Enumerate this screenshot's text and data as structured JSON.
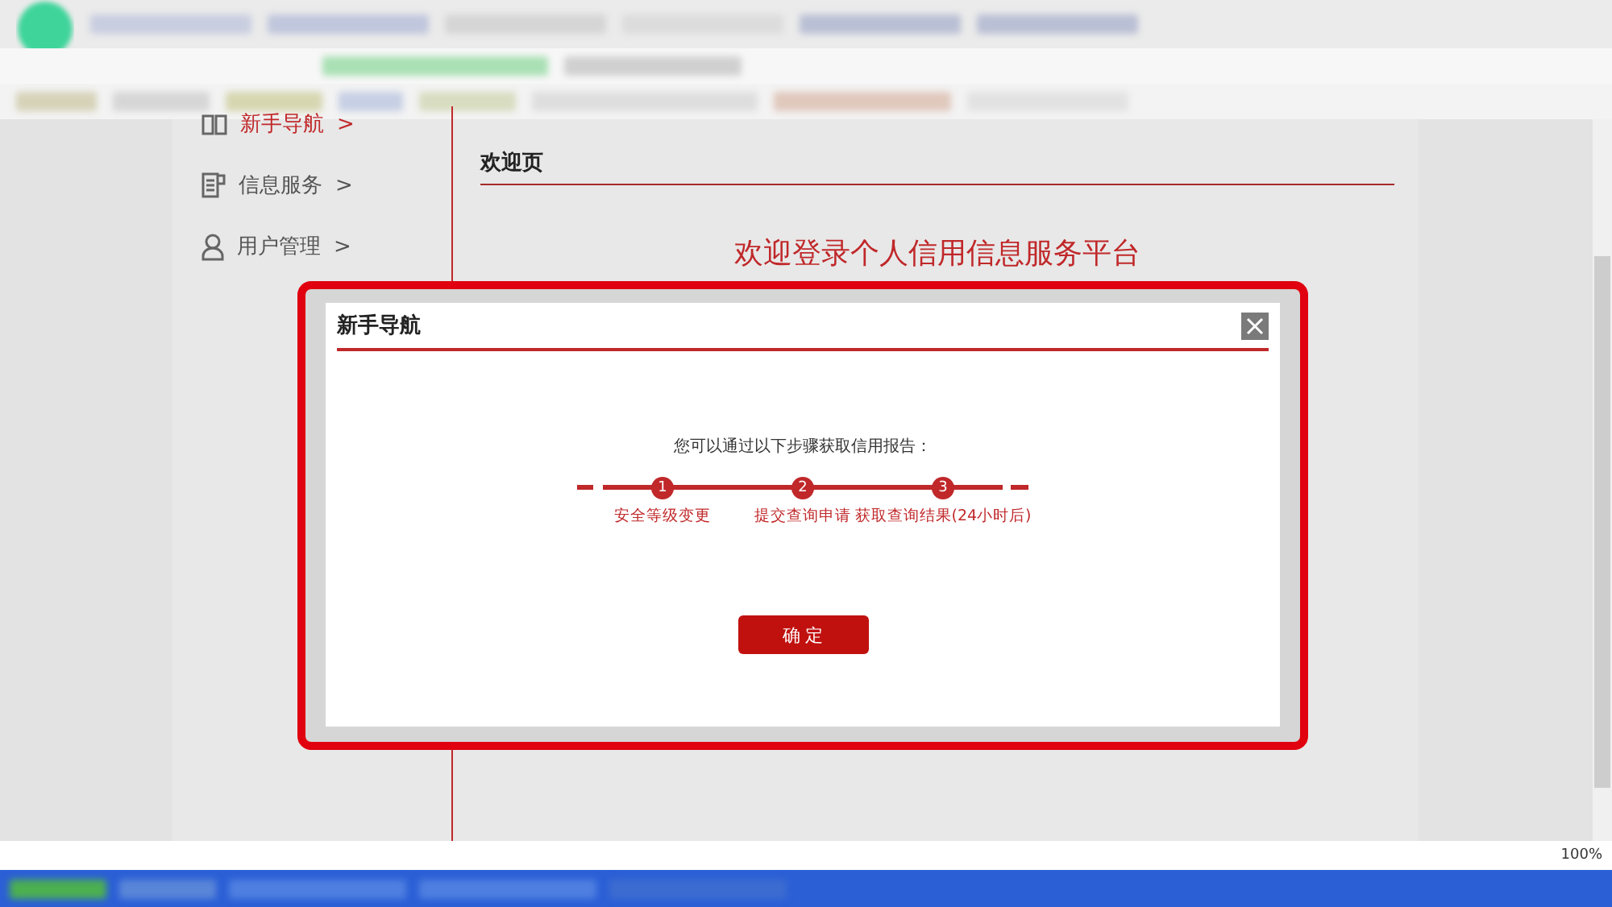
{
  "sidebar": {
    "items": [
      {
        "label": "新手导航",
        "arrow": ">",
        "selected": true
      },
      {
        "label": "信息服务",
        "arrow": ">",
        "selected": false
      },
      {
        "label": "用户管理",
        "arrow": ">",
        "selected": false
      }
    ]
  },
  "page": {
    "title": "欢迎页",
    "heading": "欢迎登录个人信用信息服务平台"
  },
  "dialog": {
    "title": "新手导航",
    "intro": "您可以通过以下步骤获取信用报告：",
    "steps": [
      {
        "number": "1",
        "label": "安全等级变更"
      },
      {
        "number": "2",
        "label": "提交查询申请"
      },
      {
        "number": "3",
        "label": "获取查询结果(24小时后)"
      }
    ],
    "button": "确 定"
  },
  "status_bar": {
    "zoom": "100%"
  }
}
